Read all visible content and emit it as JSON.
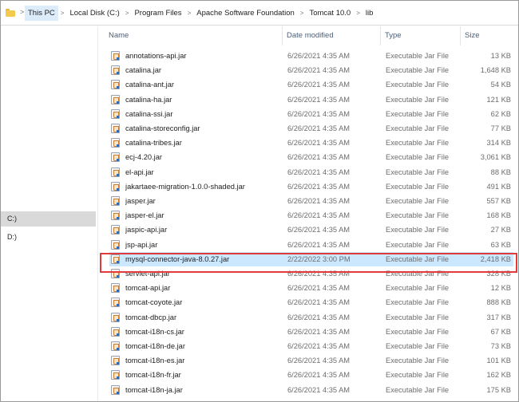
{
  "address": {
    "crumbs": [
      "This PC",
      "Local Disk (C:)",
      "Program Files",
      "Apache Software Foundation",
      "Tomcat 10.0",
      "lib"
    ],
    "separator": ">"
  },
  "nav": {
    "items": [
      {
        "label": "C:)",
        "selected": true
      },
      {
        "label": "D:)",
        "selected": false
      }
    ]
  },
  "columns": {
    "name": "Name",
    "date": "Date modified",
    "type": "Type",
    "size": "Size"
  },
  "files": [
    {
      "name": "annotations-api.jar",
      "date": "6/26/2021 4:35 AM",
      "type": "Executable Jar File",
      "size": "13 KB"
    },
    {
      "name": "catalina.jar",
      "date": "6/26/2021 4:35 AM",
      "type": "Executable Jar File",
      "size": "1,648 KB"
    },
    {
      "name": "catalina-ant.jar",
      "date": "6/26/2021 4:35 AM",
      "type": "Executable Jar File",
      "size": "54 KB"
    },
    {
      "name": "catalina-ha.jar",
      "date": "6/26/2021 4:35 AM",
      "type": "Executable Jar File",
      "size": "121 KB"
    },
    {
      "name": "catalina-ssi.jar",
      "date": "6/26/2021 4:35 AM",
      "type": "Executable Jar File",
      "size": "62 KB"
    },
    {
      "name": "catalina-storeconfig.jar",
      "date": "6/26/2021 4:35 AM",
      "type": "Executable Jar File",
      "size": "77 KB"
    },
    {
      "name": "catalina-tribes.jar",
      "date": "6/26/2021 4:35 AM",
      "type": "Executable Jar File",
      "size": "314 KB"
    },
    {
      "name": "ecj-4.20.jar",
      "date": "6/26/2021 4:35 AM",
      "type": "Executable Jar File",
      "size": "3,061 KB"
    },
    {
      "name": "el-api.jar",
      "date": "6/26/2021 4:35 AM",
      "type": "Executable Jar File",
      "size": "88 KB"
    },
    {
      "name": "jakartaee-migration-1.0.0-shaded.jar",
      "date": "6/26/2021 4:35 AM",
      "type": "Executable Jar File",
      "size": "491 KB"
    },
    {
      "name": "jasper.jar",
      "date": "6/26/2021 4:35 AM",
      "type": "Executable Jar File",
      "size": "557 KB"
    },
    {
      "name": "jasper-el.jar",
      "date": "6/26/2021 4:35 AM",
      "type": "Executable Jar File",
      "size": "168 KB"
    },
    {
      "name": "jaspic-api.jar",
      "date": "6/26/2021 4:35 AM",
      "type": "Executable Jar File",
      "size": "27 KB"
    },
    {
      "name": "jsp-api.jar",
      "date": "6/26/2021 4:35 AM",
      "type": "Executable Jar File",
      "size": "63 KB"
    },
    {
      "name": "mysql-connector-java-8.0.27.jar",
      "date": "2/22/2022 3:00 PM",
      "type": "Executable Jar File",
      "size": "2,418 KB",
      "highlighted": true
    },
    {
      "name": "servlet-api.jar",
      "date": "6/26/2021 4:35 AM",
      "type": "Executable Jar File",
      "size": "328 KB"
    },
    {
      "name": "tomcat-api.jar",
      "date": "6/26/2021 4:35 AM",
      "type": "Executable Jar File",
      "size": "12 KB"
    },
    {
      "name": "tomcat-coyote.jar",
      "date": "6/26/2021 4:35 AM",
      "type": "Executable Jar File",
      "size": "888 KB"
    },
    {
      "name": "tomcat-dbcp.jar",
      "date": "6/26/2021 4:35 AM",
      "type": "Executable Jar File",
      "size": "317 KB"
    },
    {
      "name": "tomcat-i18n-cs.jar",
      "date": "6/26/2021 4:35 AM",
      "type": "Executable Jar File",
      "size": "67 KB"
    },
    {
      "name": "tomcat-i18n-de.jar",
      "date": "6/26/2021 4:35 AM",
      "type": "Executable Jar File",
      "size": "73 KB"
    },
    {
      "name": "tomcat-i18n-es.jar",
      "date": "6/26/2021 4:35 AM",
      "type": "Executable Jar File",
      "size": "101 KB"
    },
    {
      "name": "tomcat-i18n-fr.jar",
      "date": "6/26/2021 4:35 AM",
      "type": "Executable Jar File",
      "size": "162 KB"
    },
    {
      "name": "tomcat-i18n-ja.jar",
      "date": "6/26/2021 4:35 AM",
      "type": "Executable Jar File",
      "size": "175 KB"
    }
  ],
  "colors": {
    "highlight_row": "#cce8ff",
    "annotation_border": "#e23a3a",
    "nav_selected": "#d9d9d9"
  }
}
